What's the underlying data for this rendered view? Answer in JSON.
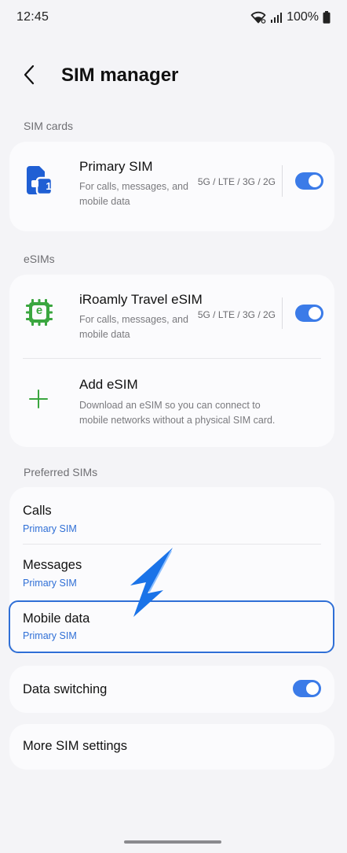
{
  "status_bar": {
    "time": "12:45",
    "battery": "100%"
  },
  "header": {
    "title": "SIM manager"
  },
  "sim_cards": {
    "label": "SIM cards",
    "primary": {
      "title": "Primary SIM",
      "description": "For calls, messages, and mobile data",
      "network": "5G / LTE / 3G / 2G",
      "enabled": true,
      "badge": "1"
    }
  },
  "esims": {
    "label": "eSIMs",
    "items": [
      {
        "title": "iRoamly Travel eSIM",
        "description": "For calls, messages, and mobile data",
        "network": "5G / LTE / 3G / 2G",
        "enabled": true,
        "badge": "e"
      }
    ],
    "add": {
      "title": "Add eSIM",
      "description": "Download an eSIM so you can connect to mobile networks without a physical SIM card."
    }
  },
  "preferred": {
    "label": "Preferred SIMs",
    "items": [
      {
        "title": "Calls",
        "value": "Primary SIM"
      },
      {
        "title": "Messages",
        "value": "Primary SIM"
      },
      {
        "title": "Mobile data",
        "value": "Primary SIM"
      }
    ]
  },
  "data_switching": {
    "label": "Data switching",
    "enabled": true
  },
  "more": {
    "label": "More SIM settings"
  },
  "colors": {
    "accent": "#3b7be8",
    "link_blue": "#2f6fd6",
    "esim_green": "#3aa63f",
    "sim_blue": "#1f5fd4",
    "background": "#f4f4f7"
  }
}
